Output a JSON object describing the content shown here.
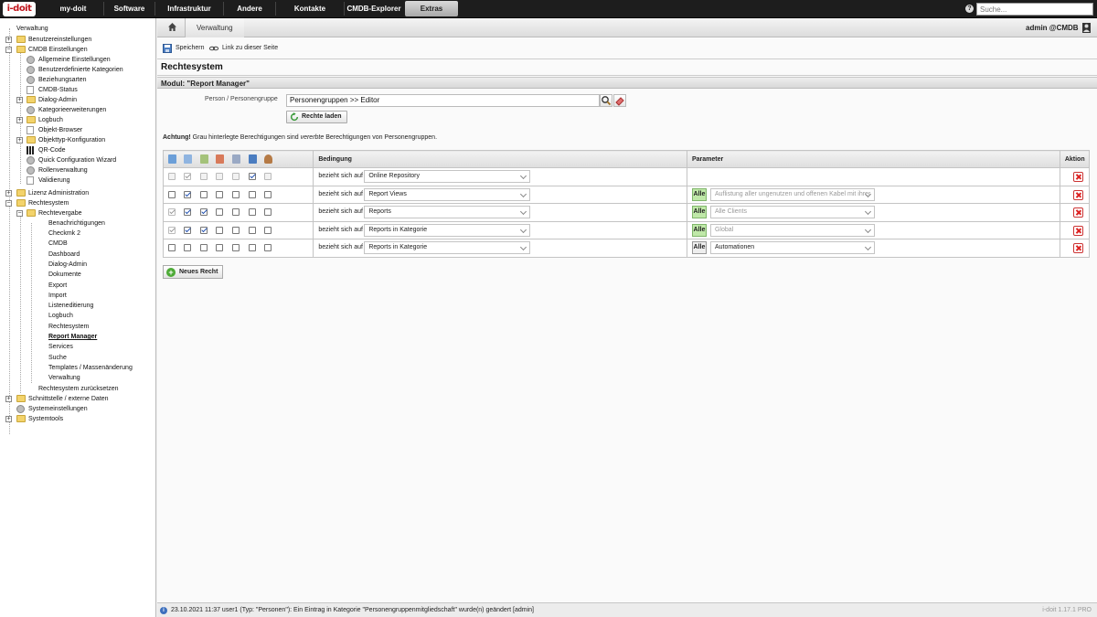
{
  "app": {
    "logo": "i-doit",
    "version": "i-doit 1.17.1 PRO"
  },
  "nav": {
    "items": [
      "my-doit",
      "Software",
      "Infrastruktur",
      "Andere",
      "Kontakte",
      "CMDB-Explorer",
      "Extras"
    ],
    "active": "Extras"
  },
  "search": {
    "placeholder": "Suche..."
  },
  "breadcrumb": {
    "current": "Verwaltung"
  },
  "user": {
    "label": "admin  @CMDB"
  },
  "toolbar": {
    "save": "Speichern",
    "link": "Link zu dieser Seite"
  },
  "tree": {
    "items": [
      "Verwaltung",
      "Benutzereinstellungen",
      "CMDB Einstellungen",
      "Allgemeine Einstellungen",
      "Benutzerdefinierte Kategorien",
      "Beziehungsarten",
      "CMDB-Status",
      "Dialog-Admin",
      "Kategorieerweiterungen",
      "Logbuch",
      "Objekt-Browser",
      "Objekttyp-Konfiguration",
      "QR-Code",
      "Quick Configuration Wizard",
      "Rollenverwaltung",
      "Validierung",
      "Lizenz Administration",
      "Rechtesystem",
      "Rechtevergabe",
      "Benachrichtigungen",
      "Checkmk 2",
      "CMDB",
      "Dashboard",
      "Dialog-Admin",
      "Dokumente",
      "Export",
      "Import",
      "Listeneditierung",
      "Logbuch",
      "Rechtesystem",
      "Report Manager",
      "Services",
      "Suche",
      "Templates / Massenänderung",
      "Verwaltung",
      "Rechtesystem zurücksetzen",
      "Schnittstelle / externe Daten",
      "Systemeinstellungen",
      "Systemtools"
    ]
  },
  "page": {
    "title": "Rechtesystem",
    "module": "Modul: \"Report Manager\"",
    "person_label": "Person / Personengruppe",
    "person_value": "Personengruppen >> Editor",
    "load_button": "Rechte laden",
    "warning_bold": "Achtung!",
    "warning_1": " Grau hinterlegte Berechtigungen sind ",
    "warning_em": "vererbte",
    "warning_2": " Berechtigungen von Personengruppen.",
    "new_right": "Neues Recht"
  },
  "table": {
    "headers": {
      "condition": "Bedingung",
      "parameter": "Parameter",
      "action": "Aktion"
    },
    "rows": [
      {
        "relation": "bezieht sich auf",
        "condition": "Online Repository",
        "all": "",
        "parameter": ""
      },
      {
        "relation": "bezieht sich auf",
        "condition": "Report Views",
        "all": "Alle",
        "parameter": "Auflistung aller ungenutzen und offenen Kabel mit ihrer"
      },
      {
        "relation": "bezieht sich auf",
        "condition": "Reports",
        "all": "Alle",
        "parameter": "Alle Clients"
      },
      {
        "relation": "bezieht sich auf",
        "condition": "Reports in Kategorie",
        "all": "Alle",
        "parameter": "Global"
      },
      {
        "relation": "bezieht sich auf",
        "condition": "Reports in Kategorie",
        "all": "Alle",
        "parameter": "Automationen"
      }
    ]
  },
  "status": {
    "text": "23.10.2021 11:37 user1 (Typ: \"Personen\"): Ein Eintrag in Kategorie \"Personengruppenmitgliedschaft\" wurde(n) geändert [admin]"
  }
}
